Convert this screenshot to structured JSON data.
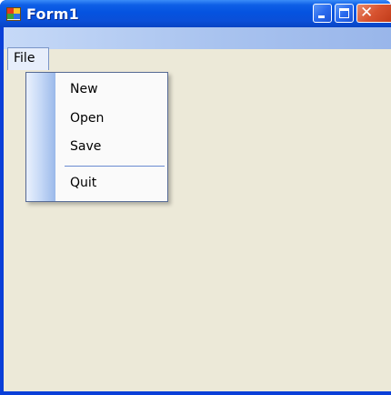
{
  "window": {
    "title": "Form1",
    "icon": "app-icon",
    "caption_buttons": [
      "minimize-icon",
      "maximize-icon",
      "close-icon"
    ]
  },
  "menubar": {
    "file_label": "File"
  },
  "file_menu": {
    "items": [
      {
        "label": "New"
      },
      {
        "label": "Open"
      },
      {
        "label": "Save"
      },
      {
        "label": "Quit"
      }
    ]
  },
  "colors": {
    "titlebar": "#0553e0",
    "client_background": "#ece9d8",
    "menubar": "#a9c3ef",
    "close_button": "#d75330"
  }
}
